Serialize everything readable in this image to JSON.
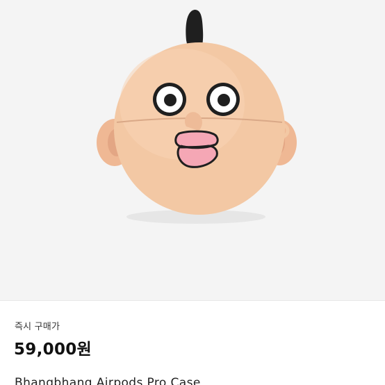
{
  "product": {
    "image_alt": "Bhangbhang Airpods Pro Case product photo",
    "price_label": "즉시 구매가",
    "price": "59,000원",
    "title": "Bhangbhang Airpods Pro Case"
  },
  "colors": {
    "background": "#f4f4f4",
    "case_skin": "#f3c8a4",
    "lips": "#f5a7b5",
    "hair": "#1f1f1f"
  }
}
